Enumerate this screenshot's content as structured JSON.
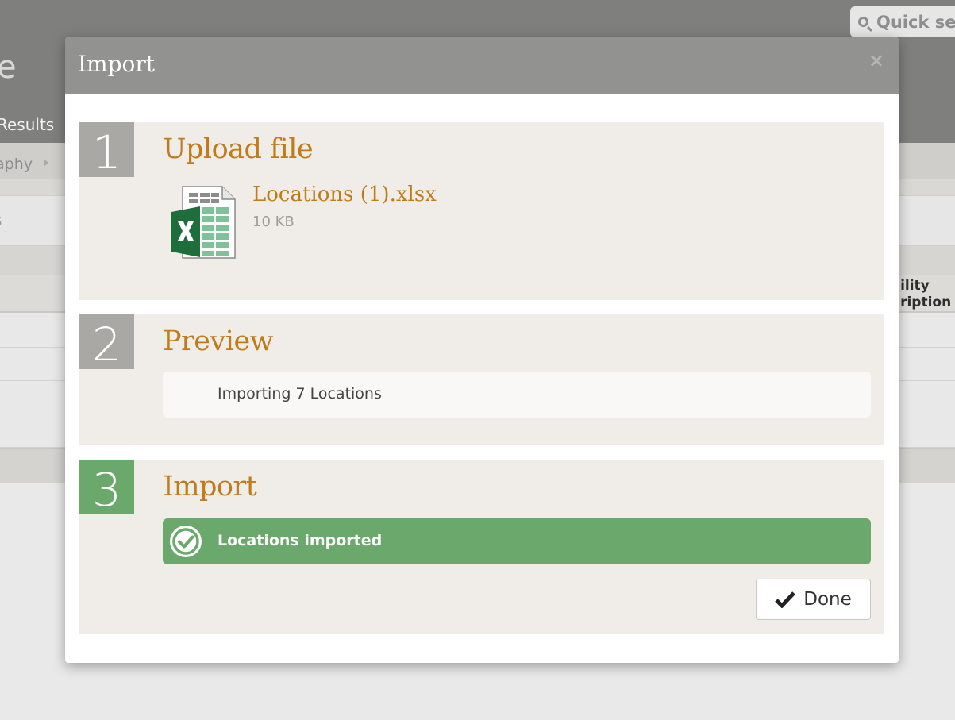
{
  "background": {
    "search_placeholder": "Quick sea",
    "page_title": "e",
    "nav_tab": "Results",
    "breadcrumb": "aphy",
    "section_label": "s",
    "table_header": [
      "cility",
      "cription"
    ]
  },
  "modal": {
    "title": "Import",
    "close_icon": "close-icon",
    "steps": [
      {
        "number": "1",
        "title": "Upload file",
        "file": {
          "name": "Locations (1).xlsx",
          "size": "10 KB",
          "icon": "excel-file-icon"
        }
      },
      {
        "number": "2",
        "title": "Preview",
        "message": "Importing 7 Locations"
      },
      {
        "number": "3",
        "title": "Import",
        "status": "Locations imported",
        "status_icon": "check-circle-icon",
        "status_color": "#6aa86b"
      }
    ],
    "done_button": {
      "label": "Done",
      "icon": "checkmark-icon"
    }
  },
  "colors": {
    "accent": "#c27b1a",
    "success": "#6aa86b",
    "step_number_bg": "#a9a8a5",
    "step_bg": "#f0ede8",
    "modal_header": "#929290"
  }
}
